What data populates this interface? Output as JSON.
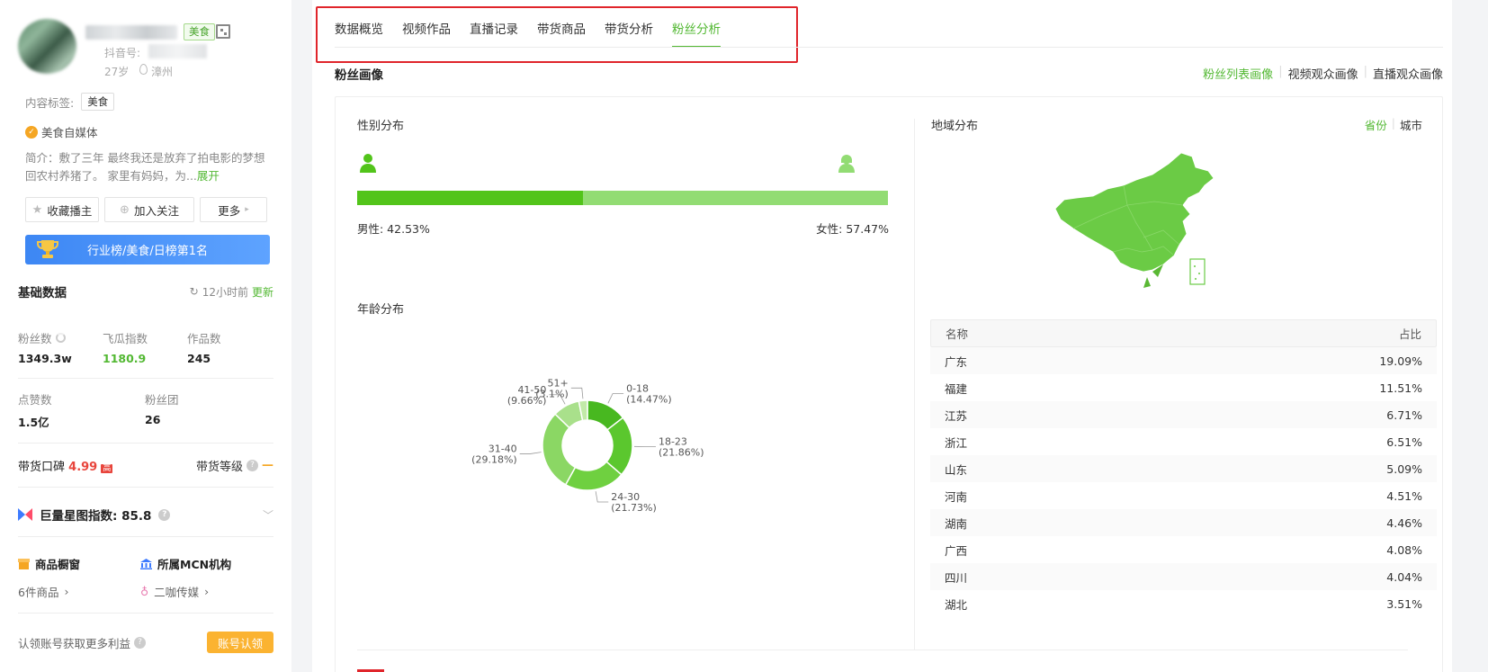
{
  "sidebar": {
    "profile": {
      "category_tag": "美食",
      "douyin_label": "抖音号:",
      "age": "27岁",
      "location": "漳州"
    },
    "content_tags": {
      "label": "内容标签:",
      "tags": [
        "美食"
      ]
    },
    "badge": "美食自媒体",
    "bio": {
      "text": "简介：敷了三年 最终我还是放弃了拍电影的梦想回农村养猪了。 家里有妈妈，为...",
      "expand": "展开"
    },
    "actions": {
      "favorite": "收藏播主",
      "follow": "加入关注",
      "more": "更多"
    },
    "rank_banner": "行业榜/美食/日榜第1名",
    "basic": {
      "title": "基础数据",
      "updated": "12小时前",
      "update_link": "更新",
      "stats": [
        {
          "label": "粉丝数",
          "value": "1349.3w"
        },
        {
          "label": "飞瓜指数",
          "value": "1180.9"
        },
        {
          "label": "作品数",
          "value": "245"
        }
      ],
      "stats2": [
        {
          "label": "点赞数",
          "value": "1.5亿"
        },
        {
          "label": "粉丝团",
          "value": "26"
        }
      ]
    },
    "koubei": {
      "label": "带货口碑",
      "value": "4.99",
      "level_badge": "高",
      "level_label": "带货等级",
      "level_value": "—"
    },
    "xingtu": {
      "label": "巨量星图指数: 85.8"
    },
    "shop": {
      "title": "商品橱窗",
      "sub": "6件商品"
    },
    "mcn": {
      "title": "所属MCN机构",
      "sub": "二咖传媒"
    },
    "claim": {
      "text": "认领账号获取更多利益",
      "button": "账号认领"
    }
  },
  "main": {
    "tabs": [
      "数据概览",
      "视频作品",
      "直播记录",
      "带货商品",
      "带货分析",
      "粉丝分析"
    ],
    "active_tab": 5,
    "section_title": "粉丝画像",
    "view_links": [
      "粉丝列表画像",
      "视频观众画像",
      "直播观众画像"
    ],
    "gender": {
      "title": "性别分布",
      "male_label": "男性: 42.53%",
      "female_label": "女性: 57.47%",
      "male_pct": 42.53,
      "female_pct": 57.47,
      "colors": {
        "male": "#52c41a",
        "female": "#92dc73"
      }
    },
    "age": {
      "title": "年龄分布"
    },
    "region": {
      "title": "地域分布",
      "toggle": [
        "省份",
        "城市"
      ],
      "table_headers": [
        "名称",
        "占比"
      ],
      "rows": [
        {
          "name": "广东",
          "pct": "19.09%"
        },
        {
          "name": "福建",
          "pct": "11.51%"
        },
        {
          "name": "江苏",
          "pct": "6.71%"
        },
        {
          "name": "浙江",
          "pct": "6.51%"
        },
        {
          "name": "山东",
          "pct": "5.09%"
        },
        {
          "name": "河南",
          "pct": "4.51%"
        },
        {
          "name": "湖南",
          "pct": "4.46%"
        },
        {
          "name": "广西",
          "pct": "4.08%"
        },
        {
          "name": "四川",
          "pct": "4.04%"
        },
        {
          "name": "湖北",
          "pct": "3.51%"
        }
      ]
    }
  },
  "chart_data": [
    {
      "type": "pie",
      "title": "年龄分布",
      "categories": [
        "0-18",
        "18-23",
        "24-30",
        "31-40",
        "41-50",
        "51+"
      ],
      "values": [
        14.47,
        21.86,
        21.73,
        29.18,
        9.66,
        3.1
      ],
      "labels": [
        "(14.47%)",
        "(21.86%)",
        "(21.73%)",
        "(29.18%)",
        "(9.66%)",
        "(3.1%)"
      ],
      "colors": [
        "#48b820",
        "#5bc72e",
        "#6fd040",
        "#8bd764",
        "#a9e08b",
        "#c2eaa8"
      ]
    },
    {
      "type": "bar",
      "title": "性别分布",
      "categories": [
        "男性",
        "女性"
      ],
      "values": [
        42.53,
        57.47
      ]
    }
  ],
  "colors": {
    "accent": "#52b832",
    "rank_blue": "#3d87f4",
    "highlight_red": "#e0252b",
    "claim_orange": "#fbb331"
  }
}
